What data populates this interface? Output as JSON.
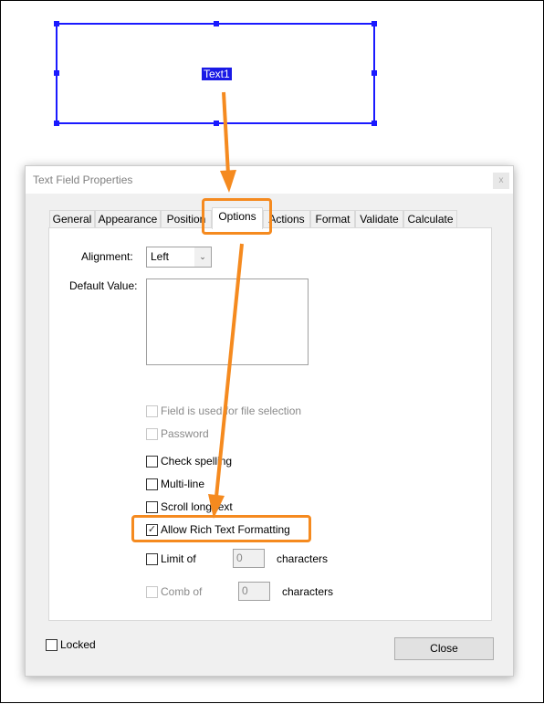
{
  "canvas": {
    "field_name": "Text1"
  },
  "dialog": {
    "title": "Text Field Properties",
    "close_x": "x",
    "tabs": [
      "General",
      "Appearance",
      "Position",
      "Options",
      "Actions",
      "Format",
      "Validate",
      "Calculate"
    ],
    "active_tab": "Options",
    "alignment_label": "Alignment:",
    "alignment_value": "Left",
    "default_value_label": "Default Value:",
    "default_value": "",
    "options": {
      "file_selection": {
        "label": "Field is used for file selection",
        "checked": false,
        "enabled": false
      },
      "password": {
        "label": "Password",
        "checked": false,
        "enabled": false
      },
      "check_spelling": {
        "label": "Check spelling",
        "checked": false,
        "enabled": true
      },
      "multi_line": {
        "label": "Multi-line",
        "checked": false,
        "enabled": true
      },
      "scroll_long_text": {
        "label": "Scroll long text",
        "checked": false,
        "enabled": true
      },
      "rich_text": {
        "label": "Allow Rich Text Formatting",
        "checked": true,
        "enabled": true
      },
      "limit_of": {
        "label": "Limit of",
        "checked": false,
        "enabled": true,
        "value": "0",
        "suffix": "characters"
      },
      "comb_of": {
        "label": "Comb of",
        "checked": false,
        "enabled": false,
        "value": "0",
        "suffix": "characters"
      }
    },
    "locked": {
      "label": "Locked",
      "checked": false
    },
    "close_button": "Close"
  },
  "colors": {
    "highlight": "#f58a1f",
    "selection": "#1a1aff"
  }
}
